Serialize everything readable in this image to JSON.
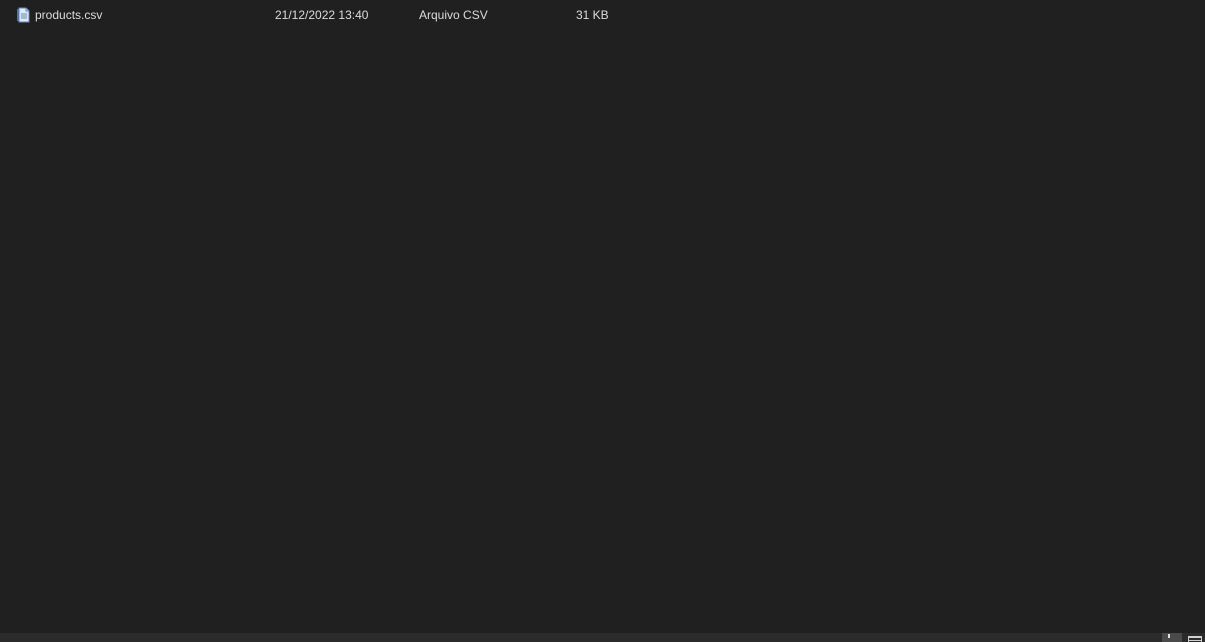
{
  "file_list": {
    "rows": [
      {
        "icon": "csv-file-icon",
        "name": "products.csv",
        "date_modified": "21/12/2022 13:40",
        "type": "Arquivo CSV",
        "size": "31 KB"
      }
    ]
  },
  "status_bar": {
    "view_buttons": [
      {
        "icon": "details-view-icon",
        "active": true
      },
      {
        "icon": "tiles-view-icon",
        "active": false
      }
    ]
  },
  "colors": {
    "background": "#202020",
    "text": "#dcdcdc",
    "status_bar": "#2b2b2b"
  }
}
